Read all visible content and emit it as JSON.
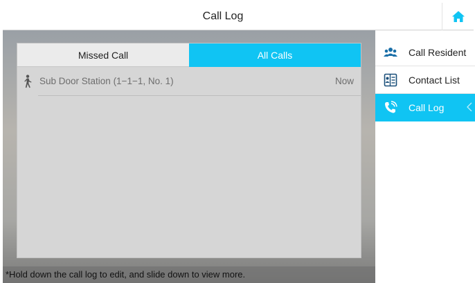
{
  "header": {
    "title": "Call Log",
    "home_icon": "home-icon"
  },
  "tabs": [
    {
      "label": "Missed Call",
      "active": false
    },
    {
      "label": "All Calls",
      "active": true
    }
  ],
  "calls": [
    {
      "name": "Sub Door Station (1−1−1, No. 1)",
      "time": "Now",
      "icon": "person-walking-icon"
    }
  ],
  "hint": "*Hold down the call log to edit, and slide down to view more.",
  "sidebar": {
    "items": [
      {
        "label": "Call Resident",
        "icon": "residents-icon",
        "active": false
      },
      {
        "label": "Contact List",
        "icon": "contact-book-icon",
        "active": false
      },
      {
        "label": "Call Log",
        "icon": "phone-log-icon",
        "active": true
      }
    ]
  },
  "colors": {
    "accent": "#10c4f3",
    "row_text": "#6d6d6d"
  }
}
